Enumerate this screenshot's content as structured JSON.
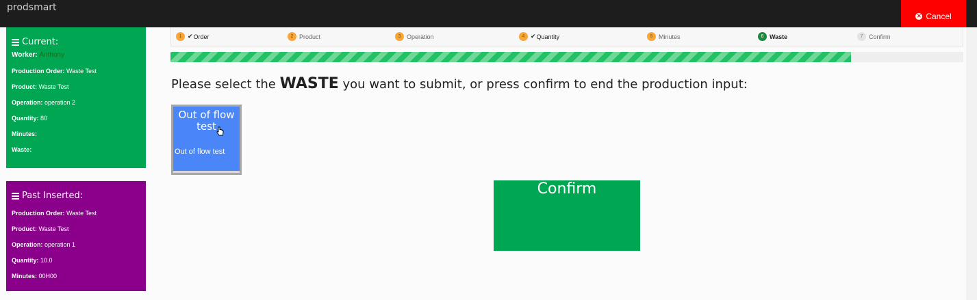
{
  "app": {
    "brand": "prodsmart",
    "cancel_label": "Cancel"
  },
  "colors": {
    "green": "#00a651",
    "purple": "#8a008a",
    "blue": "#4a86f7",
    "red": "#ff0000"
  },
  "current": {
    "title": "Current:",
    "worker_label": "Worker",
    "worker_value": "Anthony",
    "fields": [
      {
        "label": "Production Order",
        "value": "Waste Test"
      },
      {
        "label": "Product",
        "value": "Waste Test"
      },
      {
        "label": "Operation",
        "value": "operation 2"
      },
      {
        "label": "Quantity",
        "value": "80"
      },
      {
        "label": "Minutes",
        "value": ""
      },
      {
        "label": "Waste",
        "value": ""
      }
    ]
  },
  "past": {
    "title": "Past Inserted:",
    "fields": [
      {
        "label": "Production Order",
        "value": "Waste Test"
      },
      {
        "label": "Product",
        "value": "Waste Test"
      },
      {
        "label": "Operation",
        "value": "operation 1"
      },
      {
        "label": "Quantity",
        "value": "10.0"
      },
      {
        "label": "Minutes",
        "value": "00H00"
      }
    ]
  },
  "steps": [
    {
      "num": "1",
      "label": "Order",
      "state": "done"
    },
    {
      "num": "2",
      "label": "Product",
      "state": "plain"
    },
    {
      "num": "3",
      "label": "Operation",
      "state": "plain"
    },
    {
      "num": "4",
      "label": "Quantity",
      "state": "done"
    },
    {
      "num": "5",
      "label": "Minutes",
      "state": "plain"
    },
    {
      "num": "6",
      "label": "Waste",
      "state": "active"
    },
    {
      "num": "7",
      "label": "Confirm",
      "state": "todo"
    }
  ],
  "progress": {
    "fraction": 0.858
  },
  "prompt": {
    "before": "Please select the ",
    "keyword": "WASTE",
    "after": " you want to submit, or press confirm to end the production input:"
  },
  "waste_options": [
    {
      "title": "Out of flow test",
      "subtitle": "Out of flow test"
    }
  ],
  "confirm_label": "Confirm"
}
